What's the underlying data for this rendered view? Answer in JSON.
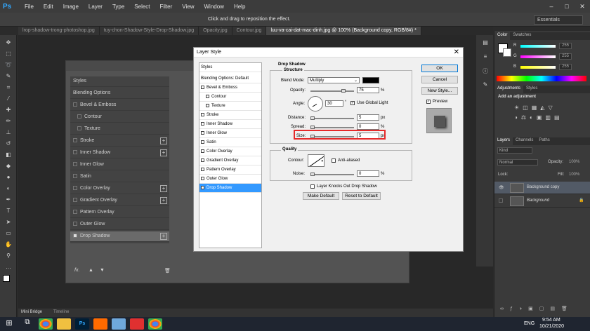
{
  "app": {
    "logo": "Ps"
  },
  "menu": [
    "File",
    "Edit",
    "Image",
    "Layer",
    "Type",
    "Select",
    "Filter",
    "View",
    "Window",
    "Help"
  ],
  "window_controls": [
    "–",
    "□",
    "✕"
  ],
  "options_bar": {
    "hint": "Click and drag to reposition the effect.",
    "workspace": "Essentials"
  },
  "doc_tabs": [
    "lrop-shadow-trong-photoshop.jpg",
    "tuy-chon-Shadow-Style-Drop-Shadow.jpg",
    "Opacity.jpg",
    "Contour.jpg",
    "luu-va-cai-dat-mac-dinh.jpg @ 100% (Background copy, RGB/8#) *"
  ],
  "bg_dialog": {
    "header": "Styles",
    "items": [
      {
        "label": "Blending Options",
        "check": false,
        "plus": false
      },
      {
        "label": "Bevel & Emboss",
        "check": true,
        "plus": false
      },
      {
        "label": "Contour",
        "check": true,
        "plus": false
      },
      {
        "label": "Texture",
        "check": true,
        "plus": false
      },
      {
        "label": "Stroke",
        "check": true,
        "plus": true
      },
      {
        "label": "Inner Shadow",
        "check": true,
        "plus": true
      },
      {
        "label": "Inner Glow",
        "check": true,
        "plus": false
      },
      {
        "label": "Satin",
        "check": true,
        "plus": false
      },
      {
        "label": "Color Overlay",
        "check": true,
        "plus": true
      },
      {
        "label": "Gradient Overlay",
        "check": true,
        "plus": true
      },
      {
        "label": "Pattern Overlay",
        "check": true,
        "plus": false
      },
      {
        "label": "Outer Glow",
        "check": true,
        "plus": false
      },
      {
        "label": "Drop Shadow",
        "check": true,
        "plus": true
      }
    ],
    "footer": "fx."
  },
  "dialog": {
    "title": "Layer Style",
    "close": "✕",
    "styles_header": "Styles",
    "styles": [
      {
        "label": "Blending Options: Default",
        "check": false,
        "indent": false,
        "selected": false
      },
      {
        "label": "Bevel & Emboss",
        "check": true,
        "indent": false,
        "selected": false
      },
      {
        "label": "Contour",
        "check": true,
        "indent": true,
        "selected": false
      },
      {
        "label": "Texture",
        "check": true,
        "indent": true,
        "selected": false
      },
      {
        "label": "Stroke",
        "check": true,
        "indent": false,
        "selected": false
      },
      {
        "label": "Inner Shadow",
        "check": true,
        "indent": false,
        "selected": false
      },
      {
        "label": "Inner Glow",
        "check": true,
        "indent": false,
        "selected": false
      },
      {
        "label": "Satin",
        "check": true,
        "indent": false,
        "selected": false
      },
      {
        "label": "Color Overlay",
        "check": true,
        "indent": false,
        "selected": false
      },
      {
        "label": "Gradient Overlay",
        "check": true,
        "indent": false,
        "selected": false
      },
      {
        "label": "Pattern Overlay",
        "check": true,
        "indent": false,
        "selected": false
      },
      {
        "label": "Outer Glow",
        "check": true,
        "indent": false,
        "selected": false
      },
      {
        "label": "Drop Shadow",
        "check": true,
        "indent": false,
        "selected": true
      }
    ],
    "section_title": "Drop Shadow",
    "structure_title": "Structure",
    "blend_mode_label": "Blend Mode:",
    "blend_mode": "Multiply",
    "opacity_label": "Opacity:",
    "opacity": "75",
    "angle_label": "Angle:",
    "angle": "30",
    "use_global_light": "Use Global Light",
    "distance_label": "Distance:",
    "distance": "5",
    "spread_label": "Spread:",
    "spread": "0",
    "size_label": "Size:",
    "size": "5",
    "unit_px": "px",
    "unit_pct": "%",
    "unit_deg": "°",
    "quality_title": "Quality",
    "contour_label": "Contour:",
    "anti_aliased": "Anti-aliased",
    "noise_label": "Noise:",
    "noise": "0",
    "knockout": "Layer Knocks Out Drop Shadow",
    "make_default": "Make Default",
    "reset_default": "Reset to Default",
    "ok": "OK",
    "cancel": "Cancel",
    "new_style": "New Style...",
    "preview": "Preview"
  },
  "right_panel": {
    "color_tabs": [
      "Color",
      "Swatches"
    ],
    "color": [
      {
        "ch": "R",
        "val": "255"
      },
      {
        "ch": "G",
        "val": "255"
      },
      {
        "ch": "B",
        "val": "255"
      }
    ],
    "adj_tabs": [
      "Adjustments",
      "Styles"
    ],
    "adj_title": "Add an adjustment",
    "layer_tabs": [
      "Layers",
      "Channels",
      "Paths"
    ],
    "kind": "Kind",
    "blend": "Normal",
    "opacity_label": "Opacity:",
    "opacity": "100%",
    "lock_label": "Lock:",
    "fill_label": "Fill:",
    "fill": "100%",
    "layers": [
      {
        "name": "Background copy",
        "selected": true
      },
      {
        "name": "Background",
        "selected": false
      }
    ]
  },
  "bottom_tabs": [
    "Mini Bridge",
    "Timeline"
  ],
  "taskbar": {
    "time": "9:54 AM",
    "date": "10/21/2020",
    "lang": "ENG"
  },
  "colors": {
    "accent": "#3399ff",
    "highlight": "#e52b2b"
  }
}
